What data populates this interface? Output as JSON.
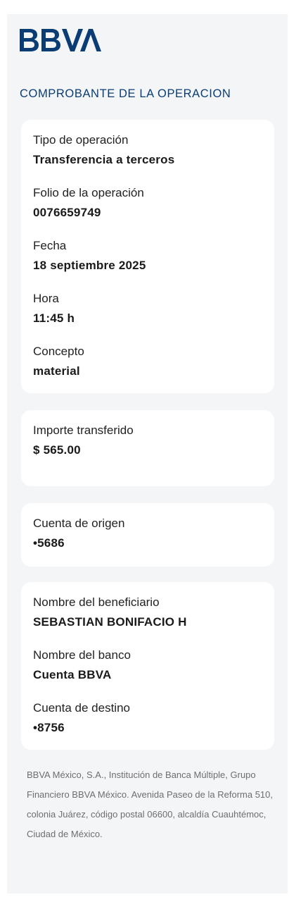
{
  "brand": {
    "logo_text": "BBVA",
    "color": "#0b3d75"
  },
  "heading": "COMPROBANTE DE LA OPERACION",
  "operation_card": {
    "fields": [
      {
        "label": "Tipo de operación",
        "value": "Transferencia a terceros"
      },
      {
        "label": "Folio de la operación",
        "value": "0076659749"
      },
      {
        "label": "Fecha",
        "value": "18 septiembre 2025"
      },
      {
        "label": "Hora",
        "value": "11:45 h"
      },
      {
        "label": "Concepto",
        "value": "material"
      }
    ]
  },
  "amount_card": {
    "label": "Importe transferido",
    "value": "$ 565.00"
  },
  "origin_card": {
    "label": "Cuenta de origen",
    "value": "•5686"
  },
  "beneficiary_card": {
    "fields": [
      {
        "label": "Nombre del beneficiario",
        "value": "SEBASTIAN BONIFACIO H"
      },
      {
        "label": "Nombre del banco",
        "value": "Cuenta BBVA"
      },
      {
        "label": "Cuenta de destino",
        "value": "•8756"
      }
    ]
  },
  "footer": {
    "legal": "BBVA México, S.A., Institución de Banca Múltiple, Grupo Financiero BBVA México. Avenida Paseo de la Reforma 510, colonia Juárez, código postal 06600, alcaldía Cuauhtémoc, Ciudad de México."
  }
}
